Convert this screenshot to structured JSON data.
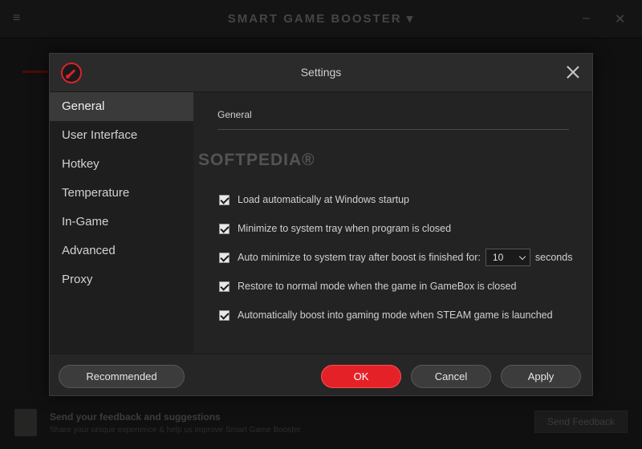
{
  "background_app": {
    "title": "SMART GAME BOOSTER ▾",
    "feedback_title": "Send your feedback and suggestions",
    "feedback_subtitle": "Share your unique experience & help us improve Smart Game Booster",
    "feedback_button": "Send Feedback"
  },
  "dialog": {
    "title": "Settings",
    "accent_color": "#e52128"
  },
  "sidebar": {
    "items": [
      {
        "label": "General",
        "active": true
      },
      {
        "label": "User Interface",
        "active": false
      },
      {
        "label": "Hotkey",
        "active": false
      },
      {
        "label": "Temperature",
        "active": false
      },
      {
        "label": "In-Game",
        "active": false
      },
      {
        "label": "Advanced",
        "active": false
      },
      {
        "label": "Proxy",
        "active": false
      }
    ]
  },
  "general": {
    "section_title": "General",
    "options": [
      {
        "label": "Load automatically at Windows startup",
        "checked": true
      },
      {
        "label": "Minimize to system tray when program is closed",
        "checked": true
      },
      {
        "label": "Auto minimize to system tray after boost is finished for:",
        "checked": true,
        "select_value": "10",
        "suffix": "seconds"
      },
      {
        "label": "Restore to normal mode when the game in GameBox is closed",
        "checked": true
      },
      {
        "label": "Automatically boost into gaming mode when STEAM game is launched",
        "checked": true
      }
    ]
  },
  "watermark": "SOFTPEDIA®",
  "footer": {
    "recommended": "Recommended",
    "ok": "OK",
    "cancel": "Cancel",
    "apply": "Apply"
  }
}
